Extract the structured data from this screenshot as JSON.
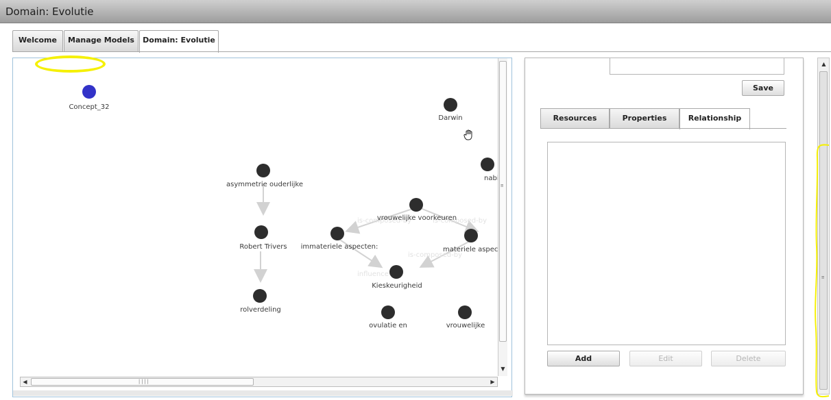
{
  "window": {
    "title": "Domain: Evolutie"
  },
  "tabs": [
    {
      "label": "Welcome"
    },
    {
      "label": "Manage Models"
    },
    {
      "label": "Domain: Evolutie"
    }
  ],
  "graph": {
    "nodes": [
      {
        "label": "Concept_32",
        "selected": true
      },
      {
        "label": "Darwin"
      },
      {
        "label": "nabijhe"
      },
      {
        "label": "asymmetrie ouderlijke"
      },
      {
        "label": "Robert Trivers"
      },
      {
        "label": "rolverdeling"
      },
      {
        "label": "vrouwelijke voorkeuren"
      },
      {
        "label": "immateriele aspecten:"
      },
      {
        "label": "materiele aspecte"
      },
      {
        "label": "Kieskeurigheid"
      },
      {
        "label": "ovulatie en"
      },
      {
        "label": "vrouwelijke"
      }
    ],
    "edge_labels": [
      {
        "text": "is-composed-by"
      },
      {
        "text": "is-composed-by"
      },
      {
        "text": "influence-on"
      },
      {
        "text": "is-composed-by"
      }
    ],
    "colors": {
      "node": "#2d2d2d",
      "selected_node": "#3232c8",
      "edge": "#d2d2d2"
    }
  },
  "panel": {
    "save_label": "Save",
    "tabs": [
      {
        "label": "Resources"
      },
      {
        "label": "Properties"
      },
      {
        "label": "Relationship"
      }
    ],
    "add_label": "Add",
    "edit_label": "Edit",
    "delete_label": "Delete"
  },
  "annotation_color": "#f5f005"
}
